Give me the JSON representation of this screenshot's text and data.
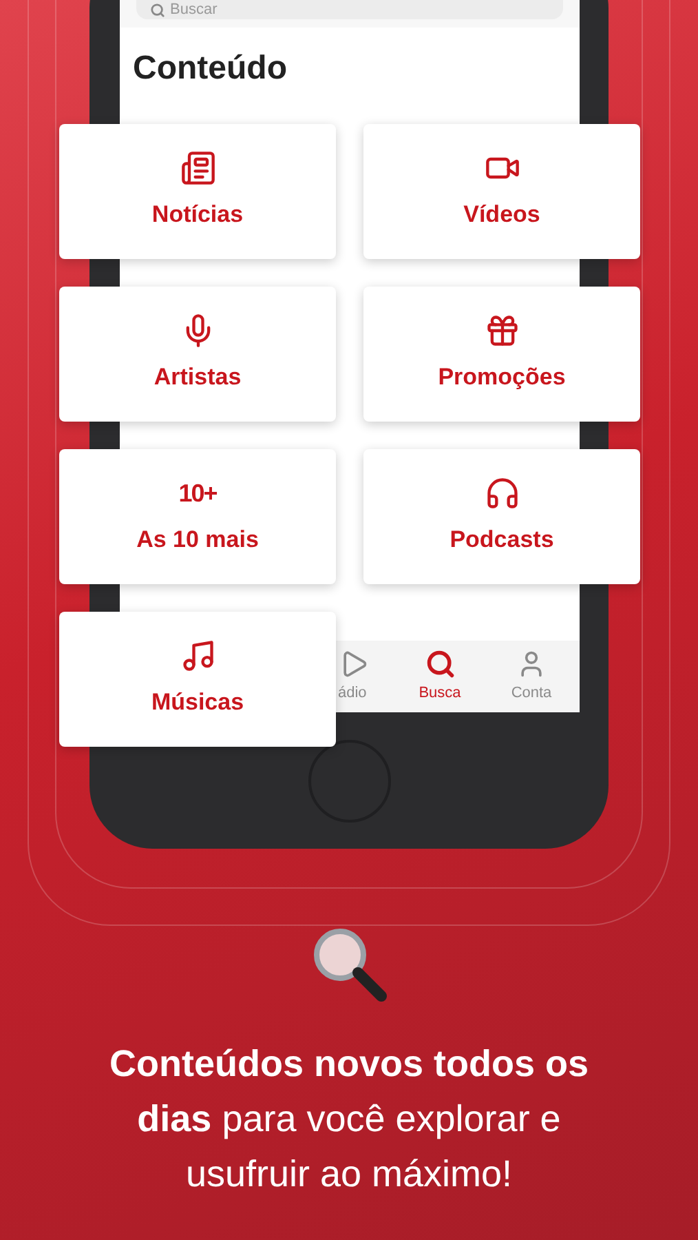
{
  "search": {
    "placeholder": "Buscar"
  },
  "screen_title": "Conteúdo",
  "cards": [
    {
      "label": "Notícias"
    },
    {
      "label": "Vídeos"
    },
    {
      "label": "Artistas"
    },
    {
      "label": "Promoções"
    },
    {
      "label": "As 10 mais",
      "mark": "10+"
    },
    {
      "label": "Podcasts"
    },
    {
      "label": "Músicas"
    }
  ],
  "tab_bar": [
    {
      "label": "ádio",
      "selected": false
    },
    {
      "label": "Busca",
      "selected": true
    },
    {
      "label": "Conta",
      "selected": false
    }
  ],
  "headline": "**Conteúdos novos todos os dias** para você explorar e usufruir ao máximo!"
}
